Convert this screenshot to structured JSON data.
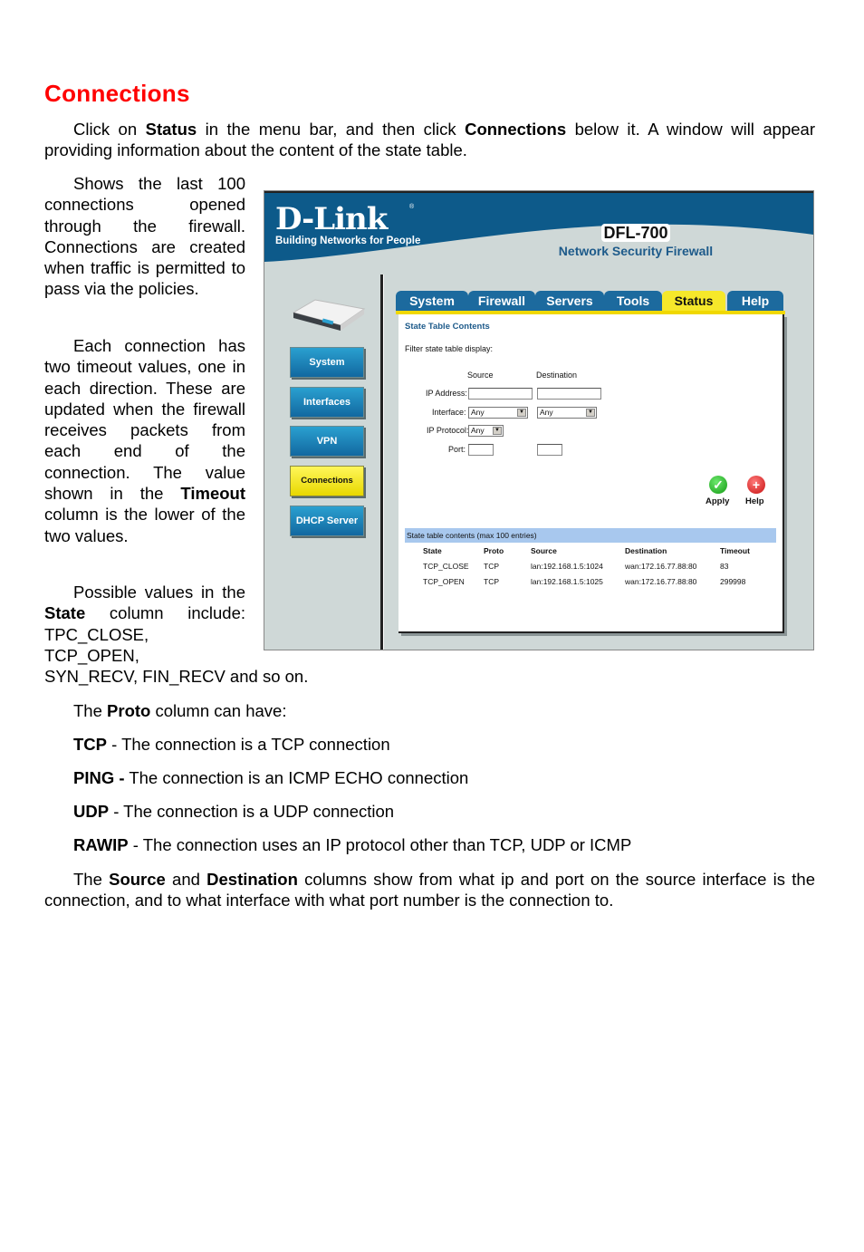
{
  "heading": "Connections",
  "intro": {
    "pre": "Click on ",
    "b1": "Status",
    "mid": " in the menu bar, and then click ",
    "b2": "Connections",
    "post": " below it. A window will appear providing information about the content of the state table."
  },
  "side_paragraphs": {
    "p1": "Shows the last 100 connections opened through the firewall. Connections are created when traffic is permitted to pass via the policies.",
    "p2_pre": "Each connection has two timeout values, one in each direction. These are updated when the firewall receives packets from each end of the connection. The value shown in the ",
    "p2_b": "Timeout",
    "p2_post": " column is the lower of the two values.",
    "p3_pre": "Possible values in the ",
    "p3_b": "State",
    "p3_post": " column include: TPC_CLOSE, TCP_OPEN, SYN_RECV, FIN_RECV and so on."
  },
  "proto": {
    "intro_pre": "The ",
    "intro_b": "Proto",
    "intro_post": " column can have:",
    "items": [
      {
        "b": "TCP",
        "text": " - The connection is a TCP connection"
      },
      {
        "b": "PING -",
        "text": " The connection is an ICMP ECHO connection"
      },
      {
        "b": "UDP",
        "text": " - The connection is a UDP connection"
      },
      {
        "b": "RAWIP",
        "text": " - The connection uses an IP protocol other than TCP, UDP or ICMP"
      }
    ]
  },
  "closing": {
    "pre": "The ",
    "b1": "Source",
    "mid": " and ",
    "b2": "Destination",
    "post": " columns show from what ip and port on the source interface is the connection, and to what interface with what port number is the connection to."
  },
  "screenshot": {
    "brand": "D-Link",
    "brand_reg": "®",
    "tagline": "Building Networks for People",
    "model": "DFL-700",
    "model_subtitle": "Network Security Firewall",
    "tabs": [
      {
        "label": "System",
        "active": false
      },
      {
        "label": "Firewall",
        "active": false
      },
      {
        "label": "Servers",
        "active": false
      },
      {
        "label": "Tools",
        "active": false
      },
      {
        "label": "Status",
        "active": true
      },
      {
        "label": "Help",
        "active": false
      }
    ],
    "side_nav": [
      {
        "label": "System",
        "active": false
      },
      {
        "label": "Interfaces",
        "active": false
      },
      {
        "label": "VPN",
        "active": false
      },
      {
        "label": "Connections",
        "active": true
      },
      {
        "label": "DHCP Server",
        "active": false
      }
    ],
    "panel_title": "State Table Contents",
    "filter_label": "Filter state table display:",
    "col_source": "Source",
    "col_destination": "Destination",
    "fields": {
      "ip_address_label": "IP Address:",
      "ip_address_source": "",
      "ip_address_destination": "",
      "interface_label": "Interface:",
      "interface_source": "Any",
      "interface_destination": "Any",
      "ip_protocol_label": "IP Protocol:",
      "ip_protocol_value": "Any",
      "port_label": "Port:",
      "port_source": "",
      "port_destination": ""
    },
    "apply_label": "Apply",
    "help_label": "Help",
    "apply_icon": "check-circle-icon",
    "help_icon": "plus-circle-icon",
    "table_caption": "State table contents (max 100 entries)",
    "table_headers": [
      "State",
      "Proto",
      "Source",
      "Destination",
      "Timeout"
    ],
    "table_rows": [
      [
        "TCP_CLOSE",
        "TCP",
        "lan:192.168.1.5:1024",
        "wan:172.16.77.88:80",
        "83"
      ],
      [
        "TCP_OPEN",
        "TCP",
        "lan:192.168.1.5:1025",
        "wan:172.16.77.88:80",
        "299998"
      ]
    ],
    "colors": {
      "header_blue": "#0d5a8a",
      "tab_blue": "#1c6a9e",
      "active_yellow": "#f6e82a",
      "bg_gray": "#cfd8d7",
      "table_caption_bg": "#a8c8ee"
    }
  }
}
